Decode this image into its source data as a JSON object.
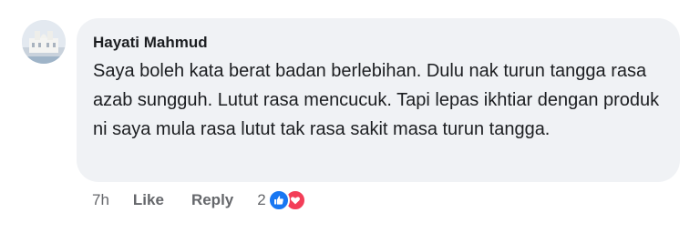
{
  "comment": {
    "author": "Hayati Mahmud",
    "text": "Saya boleh kata berat badan berlebihan. Dulu nak turun tangga rasa azab sungguh. Lutut rasa mencucuk. Tapi lepas ikhtiar dengan produk ni saya mula rasa lutut tak rasa sakit masa turun tangga.",
    "time": "7h",
    "like_label": "Like",
    "reply_label": "Reply",
    "reaction_count": "2",
    "reactions": [
      "like-icon",
      "love-icon"
    ]
  },
  "colors": {
    "bubble_bg": "#f0f2f5",
    "text": "#1c1e21",
    "secondary_text": "#65676b",
    "like_blue": "#1877f2",
    "love_red": "#f33e58"
  }
}
